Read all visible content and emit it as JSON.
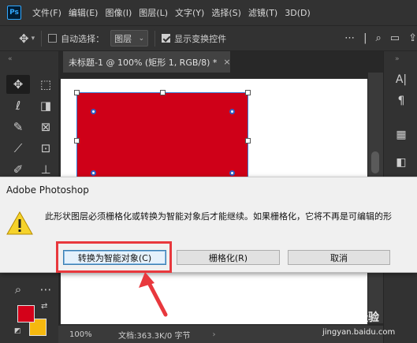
{
  "app": {
    "logo": "Ps"
  },
  "menu": {
    "items": [
      "文件(F)",
      "编辑(E)",
      "图像(I)",
      "图层(L)",
      "文字(Y)",
      "选择(S)",
      "滤镜(T)",
      "3D(D)"
    ]
  },
  "options": {
    "auto_select_label": "自动选择：",
    "layer_select_value": "图层",
    "show_transform_label": "显示变换控件"
  },
  "document": {
    "tab_title": "未标题-1 @ 100% (矩形 1, RGB/8) *",
    "close_glyph": "×",
    "shape_color": "#cf0018"
  },
  "status": {
    "zoom": "100%",
    "doc_info": "文档:363.3K/0 字节",
    "arrow": "›"
  },
  "colors": {
    "foreground": "#d40119",
    "background": "#f5b80f"
  },
  "dialog": {
    "title": "Adobe Photoshop",
    "message": "此形状图层必须栅格化或转换为智能对象后才能继续。如果栅格化，它将不再是可编辑的形",
    "buttons": {
      "convert": "转换为智能对象(C)",
      "rasterize": "栅格化(R)",
      "cancel": "取消"
    }
  },
  "watermark": {
    "brand": "经验",
    "url": "jingyan.baidu.com"
  }
}
